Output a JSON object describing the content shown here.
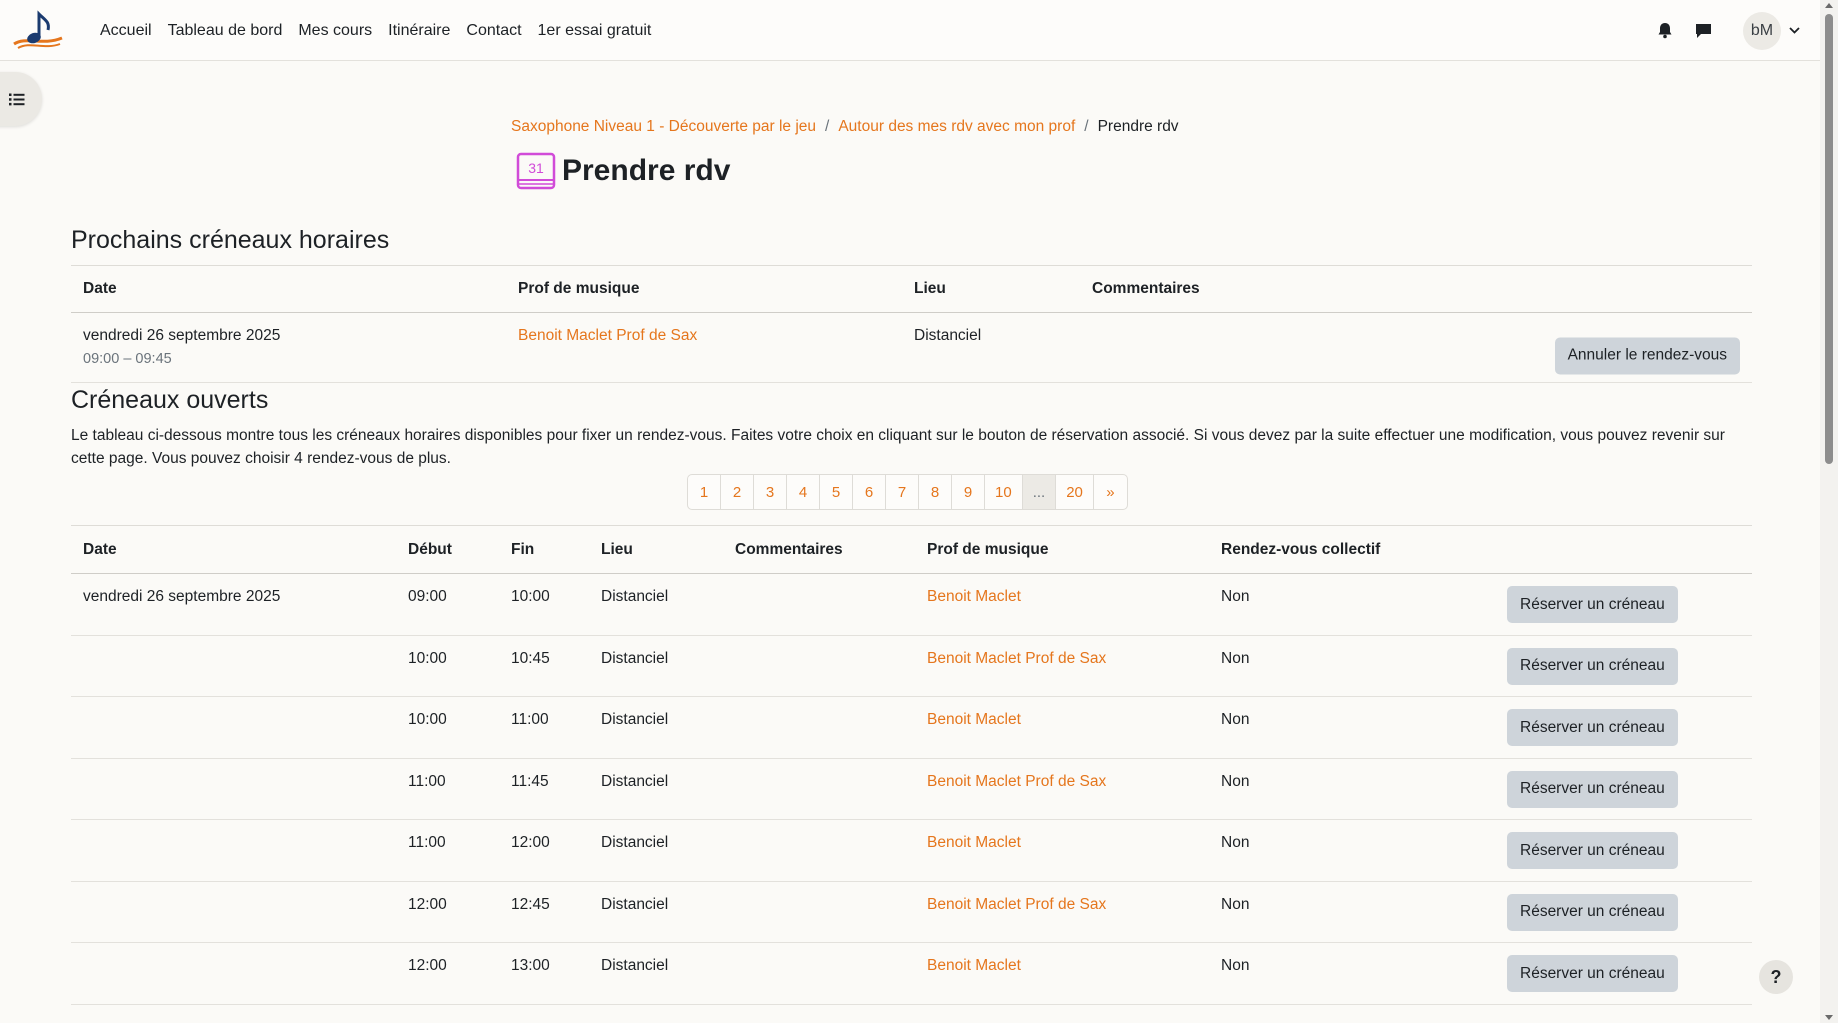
{
  "navbar": {
    "links": [
      "Accueil",
      "Tableau de bord",
      "Mes cours",
      "Itinéraire",
      "Contact",
      "1er essai gratuit"
    ],
    "avatar_initials": "bM"
  },
  "breadcrumb": {
    "items": [
      "Saxophone Niveau 1 - Découverte par le jeu",
      "Autour des mes rdv avec mon prof",
      "Prendre rdv"
    ],
    "separator": "/"
  },
  "page": {
    "title": "Prendre rdv",
    "calendar_icon_text": "31"
  },
  "upcoming": {
    "heading": "Prochains créneaux horaires",
    "columns": [
      "Date",
      "Prof de musique",
      "Lieu",
      "Commentaires"
    ],
    "rows": [
      {
        "date": "vendredi 26 septembre 2025",
        "time": "09:00 – 09:45",
        "teacher": "Benoit Maclet Prof de Sax",
        "place": "Distanciel",
        "comment": "",
        "action": "Annuler le rendez-vous"
      }
    ]
  },
  "open_slots": {
    "heading": "Créneaux ouverts",
    "intro": "Le tableau ci-dessous montre tous les créneaux horaires disponibles pour fixer un rendez-vous. Faites votre choix en cliquant sur le bouton de réservation associé. Si vous devez par la suite effectuer une modification, vous pouvez revenir sur cette page. Vous pouvez choisir 4 rendez-vous de plus.",
    "pagination": [
      "1",
      "2",
      "3",
      "4",
      "5",
      "6",
      "7",
      "8",
      "9",
      "10",
      "...",
      "20",
      "»"
    ],
    "columns": [
      "Date",
      "Début",
      "Fin",
      "Lieu",
      "Commentaires",
      "Prof de musique",
      "Rendez-vous collectif"
    ],
    "book_label": "Réserver un créneau",
    "rows": [
      {
        "date": "vendredi 26 septembre 2025",
        "start": "09:00",
        "end": "10:00",
        "place": "Distanciel",
        "comment": "",
        "teacher": "Benoit Maclet",
        "group": "Non"
      },
      {
        "date": "",
        "start": "10:00",
        "end": "10:45",
        "place": "Distanciel",
        "comment": "",
        "teacher": "Benoit Maclet Prof de Sax",
        "group": "Non"
      },
      {
        "date": "",
        "start": "10:00",
        "end": "11:00",
        "place": "Distanciel",
        "comment": "",
        "teacher": "Benoit Maclet",
        "group": "Non"
      },
      {
        "date": "",
        "start": "11:00",
        "end": "11:45",
        "place": "Distanciel",
        "comment": "",
        "teacher": "Benoit Maclet Prof de Sax",
        "group": "Non"
      },
      {
        "date": "",
        "start": "11:00",
        "end": "12:00",
        "place": "Distanciel",
        "comment": "",
        "teacher": "Benoit Maclet",
        "group": "Non"
      },
      {
        "date": "",
        "start": "12:00",
        "end": "12:45",
        "place": "Distanciel",
        "comment": "",
        "teacher": "Benoit Maclet Prof de Sax",
        "group": "Non"
      },
      {
        "date": "",
        "start": "12:00",
        "end": "13:00",
        "place": "Distanciel",
        "comment": "",
        "teacher": "Benoit Maclet",
        "group": "Non"
      }
    ]
  },
  "help": {
    "label": "?"
  },
  "colors": {
    "accent": "#e5761d",
    "button_bg": "#ced4da",
    "calendar_icon": "#d14bd8"
  }
}
